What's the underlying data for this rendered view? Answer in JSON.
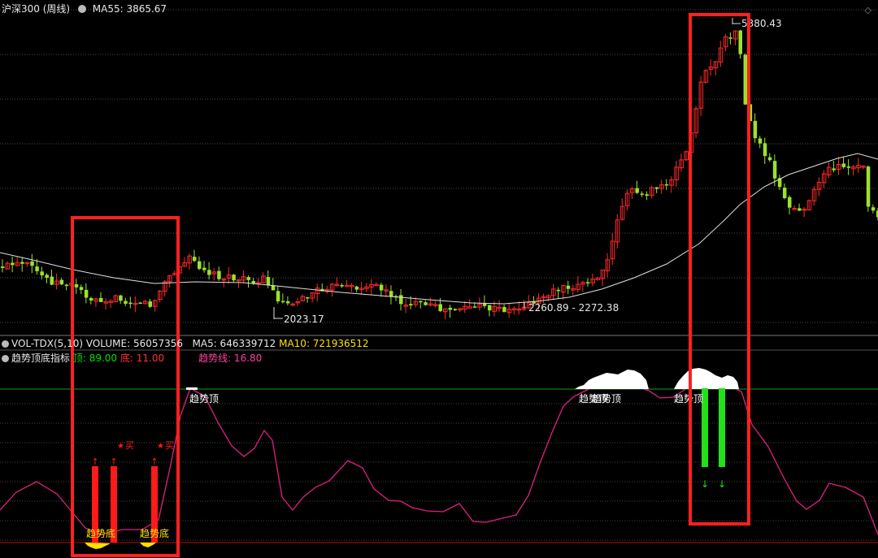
{
  "price_panel": {
    "title": "沪深300 (周线)",
    "ma_label": "MA55: 3865.67",
    "high_label": "5380.43",
    "low_label": "2023.17",
    "range_label": "2260.89 - 2272.38"
  },
  "volume_panel": {
    "name": "VOL-TDX(5,10)",
    "volume": "VOLUME: 56057356",
    "ma5": "MA5: 646339712",
    "ma10": "MA10: 721936512"
  },
  "indicator_panel": {
    "name": "趋势顶底指标",
    "top": "顶: 89.00",
    "bottom": "底: 11.00",
    "trend": "趋势线: 16.80",
    "label_top": "趋势顶",
    "label_bottom": "趋势底",
    "label_buy": "买"
  },
  "colors": {
    "background": "#000000",
    "up": "#ff2a2a",
    "down": "#9be22d",
    "ma_line": "#e0e0e0",
    "trend_line": "#e02080",
    "highlight_box": "#ff2020",
    "buy_bar": "#ff1a1a",
    "sell_bar": "#22e01a"
  },
  "chart_data": {
    "type": "line",
    "series": [
      {
        "name": "MA55",
        "values": []
      },
      {
        "name": "趋势线",
        "values": []
      }
    ]
  }
}
